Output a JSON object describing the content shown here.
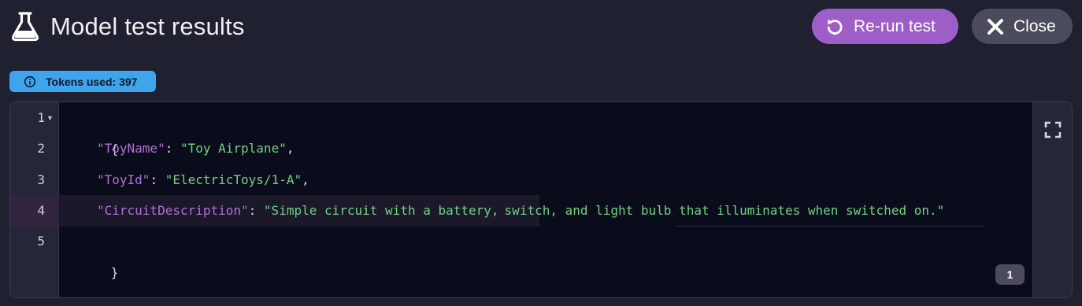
{
  "header": {
    "title": "Model test results",
    "title_icon": "flask-icon",
    "rerun_label": "Re-run test",
    "rerun_icon": "rotate-ccw-icon",
    "close_label": "Close",
    "close_icon": "close-icon"
  },
  "tokens_badge": {
    "label": "Tokens used: 397",
    "icon": "info-icon"
  },
  "editor": {
    "line_numbers": [
      "1",
      "2",
      "3",
      "4",
      "5"
    ],
    "active_line": 4,
    "lines": {
      "l1": "{",
      "l2_key": "\"ToyName\"",
      "l2_sep": ": ",
      "l2_val": "\"Toy Airplane\"",
      "l2_end": ",",
      "l3_key": "\"ToyId\"",
      "l3_sep": ": ",
      "l3_val": "\"ElectricToys/1-A\"",
      "l3_end": ",",
      "l4_key": "\"CircuitDescription\"",
      "l4_sep": ": ",
      "l4_val_a": "\"Simple circuit with a battery,",
      "l4_val_b": "switch, and light bulb that illuminates when switched on.\"",
      "l5": "}"
    },
    "expand_icon": "fullscreen-icon",
    "page_badge": "1"
  },
  "colors": {
    "background": "#1f2030",
    "rerun_button": "#9d5fc7",
    "close_button": "#4a4b5c",
    "tokens_badge": "#3ea4ee",
    "json_key": "#b36fd6",
    "json_string": "#6ed284",
    "editor_background": "#0b0c1b"
  }
}
